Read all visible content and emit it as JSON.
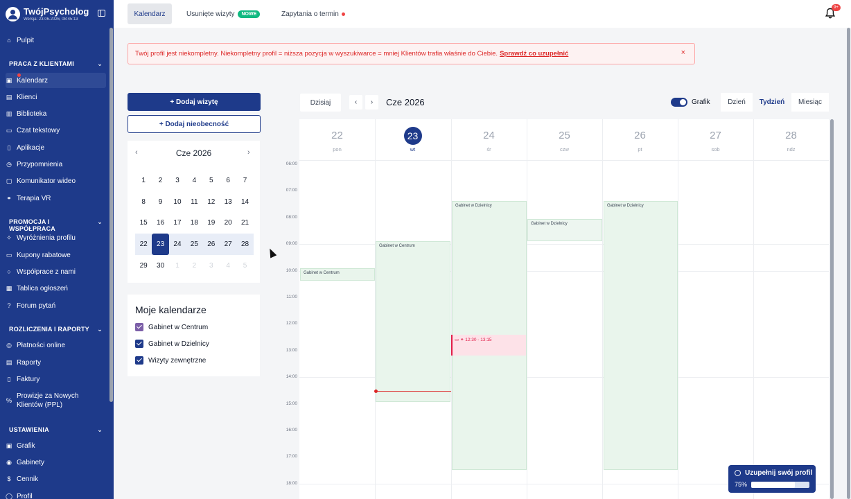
{
  "brand": {
    "name": "TwójPsycholog",
    "version": "Wersja: 23.06.2026, 08:45:13"
  },
  "sidebar": {
    "pulpit": "Pulpit",
    "sections": [
      {
        "title": "PRACA Z KLIENTAMI"
      },
      {
        "title": "PROMOCJA I WSPÓŁPRACA"
      },
      {
        "title": "ROZLICZENIA I RAPORTY"
      },
      {
        "title": "USTAWIENIA"
      }
    ],
    "items": [
      {
        "label": "Kalendarz"
      },
      {
        "label": "Klienci"
      },
      {
        "label": "Biblioteka"
      },
      {
        "label": "Czat tekstowy"
      },
      {
        "label": "Aplikacje"
      },
      {
        "label": "Przypomnienia"
      },
      {
        "label": "Komunikator wideo"
      },
      {
        "label": "Terapia VR"
      },
      {
        "label": "Wyróżnienia profilu"
      },
      {
        "label": "Kupony rabatowe"
      },
      {
        "label": "Współprace z nami"
      },
      {
        "label": "Tablica ogłoszeń"
      },
      {
        "label": "Forum pytań"
      },
      {
        "label": "Płatności online"
      },
      {
        "label": "Raporty"
      },
      {
        "label": "Faktury"
      },
      {
        "label": "Prowizje za Nowych"
      },
      {
        "label": "Grafik"
      },
      {
        "label": "Gabinety"
      },
      {
        "label": "Cennik"
      },
      {
        "label": "Profil"
      }
    ],
    "ppl_line2": "Klientów (PPL)"
  },
  "tabs": {
    "kalendarz": "Kalendarz",
    "usuniete": "Usunięte wizyty",
    "nowe_badge": "NOWE",
    "zapytania": "Zapytania o termin"
  },
  "notifications_badge": "9+",
  "alert": {
    "text": "Twój profil jest niekompletny. Niekompletny profil = niższa pozycja w wyszukiwarce = mniej Klientów trafia właśnie do Ciebie.",
    "link": "Sprawdź co uzupełnić",
    "close": "×"
  },
  "actions": {
    "add_visit": "+ Dodaj wizytę",
    "add_absence": "+ Dodaj nieobecność"
  },
  "mini_calendar": {
    "title": "Cze 2026",
    "weeks": [
      [
        "1",
        "2",
        "3",
        "4",
        "5",
        "6",
        "7"
      ],
      [
        "8",
        "9",
        "10",
        "11",
        "12",
        "13",
        "14"
      ],
      [
        "15",
        "16",
        "17",
        "18",
        "19",
        "20",
        "21"
      ],
      [
        "22",
        "23",
        "24",
        "25",
        "26",
        "27",
        "28"
      ],
      [
        "29",
        "30",
        "1",
        "2",
        "3",
        "4",
        "5"
      ]
    ]
  },
  "my_calendars": {
    "title": "Moje kalendarze",
    "items": [
      {
        "label": "Gabinet w Centrum",
        "color": "#7c5fa8"
      },
      {
        "label": "Gabinet w Dzielnicy",
        "color": "#1e3a8a"
      },
      {
        "label": "Wizyty zewnętrzne",
        "color": "#1e3a8a"
      }
    ]
  },
  "toolbar": {
    "today": "Dzisiaj",
    "title": "Cze 2026",
    "grafik": "Grafik",
    "views": [
      "Dzień",
      "Tydzień",
      "Miesiąc"
    ],
    "active_view": "Tydzień"
  },
  "week": {
    "days": [
      {
        "num": "22",
        "name": "pon"
      },
      {
        "num": "23",
        "name": "wt"
      },
      {
        "num": "24",
        "name": "śr"
      },
      {
        "num": "25",
        "name": "czw"
      },
      {
        "num": "26",
        "name": "pt"
      },
      {
        "num": "27",
        "name": "sob"
      },
      {
        "num": "28",
        "name": "ndz"
      }
    ],
    "hours": [
      "06:00",
      "07:00",
      "08:00",
      "09:00",
      "10:00",
      "11:00",
      "12:00",
      "13:00",
      "14:00",
      "15:00",
      "16:00",
      "17:00",
      "18:00"
    ]
  },
  "events": [
    {
      "label": "Gabinet w Centrum"
    },
    {
      "label": "Gabinet w Centrum"
    },
    {
      "label": "Gabinet w Dzielnicy"
    },
    {
      "label": "Gabinet w Dzielnicy"
    },
    {
      "label": "Gabinet w Dzielnicy"
    }
  ],
  "appointment": {
    "time": "12:30 - 13:15"
  },
  "profile_progress": {
    "title": "Uzupełnij swój profil",
    "percent_label": "75%",
    "fraction": 0.75
  },
  "colors": {
    "primary": "#1e3a8a",
    "alert": "#dc2626",
    "event_bg": "#e9f5ec",
    "appointment_bg": "#fde2e8"
  }
}
